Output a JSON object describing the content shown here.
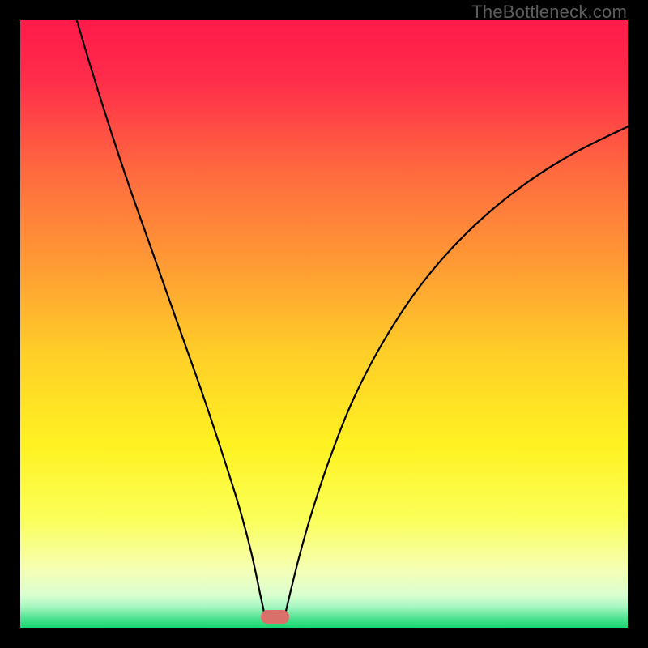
{
  "watermark": "TheBottleneck.com",
  "chart_data": {
    "type": "line",
    "title": "",
    "xlabel": "",
    "ylabel": "",
    "xlim": [
      0,
      100
    ],
    "ylim": [
      0,
      100
    ],
    "curves": {
      "left": [
        {
          "x": 9.3,
          "y": 100.0
        },
        {
          "x": 12.0,
          "y": 91.0
        },
        {
          "x": 15.0,
          "y": 81.5
        },
        {
          "x": 18.0,
          "y": 72.5
        },
        {
          "x": 21.0,
          "y": 64.0
        },
        {
          "x": 24.0,
          "y": 55.5
        },
        {
          "x": 27.0,
          "y": 47.0
        },
        {
          "x": 30.0,
          "y": 38.5
        },
        {
          "x": 33.0,
          "y": 29.5
        },
        {
          "x": 36.0,
          "y": 20.0
        },
        {
          "x": 38.0,
          "y": 12.5
        },
        {
          "x": 39.5,
          "y": 5.5
        },
        {
          "x": 40.3,
          "y": 1.8
        }
      ],
      "right": [
        {
          "x": 43.5,
          "y": 1.8
        },
        {
          "x": 44.5,
          "y": 6.0
        },
        {
          "x": 46.0,
          "y": 12.0
        },
        {
          "x": 48.0,
          "y": 19.0
        },
        {
          "x": 51.0,
          "y": 28.0
        },
        {
          "x": 55.0,
          "y": 38.0
        },
        {
          "x": 60.0,
          "y": 47.5
        },
        {
          "x": 66.0,
          "y": 56.5
        },
        {
          "x": 73.0,
          "y": 64.5
        },
        {
          "x": 81.0,
          "y": 71.5
        },
        {
          "x": 90.0,
          "y": 77.5
        },
        {
          "x": 100.0,
          "y": 82.5
        }
      ]
    },
    "marker": {
      "x_center": 41.9,
      "y_center": 1.8,
      "width_pct": 4.6,
      "height_pct": 2.2,
      "color": "#d9706a"
    },
    "gradient_stops": [
      {
        "offset": 0.0,
        "color": "#ff1a4a"
      },
      {
        "offset": 0.1,
        "color": "#ff2d4a"
      },
      {
        "offset": 0.25,
        "color": "#ff6a3f"
      },
      {
        "offset": 0.4,
        "color": "#ff9a34"
      },
      {
        "offset": 0.55,
        "color": "#ffcf28"
      },
      {
        "offset": 0.7,
        "color": "#fff222"
      },
      {
        "offset": 0.82,
        "color": "#fbff58"
      },
      {
        "offset": 0.9,
        "color": "#f6ffb0"
      },
      {
        "offset": 0.945,
        "color": "#dcffd0"
      },
      {
        "offset": 0.965,
        "color": "#a7f7c1"
      },
      {
        "offset": 0.985,
        "color": "#4be28f"
      },
      {
        "offset": 1.0,
        "color": "#17d66e"
      }
    ]
  }
}
